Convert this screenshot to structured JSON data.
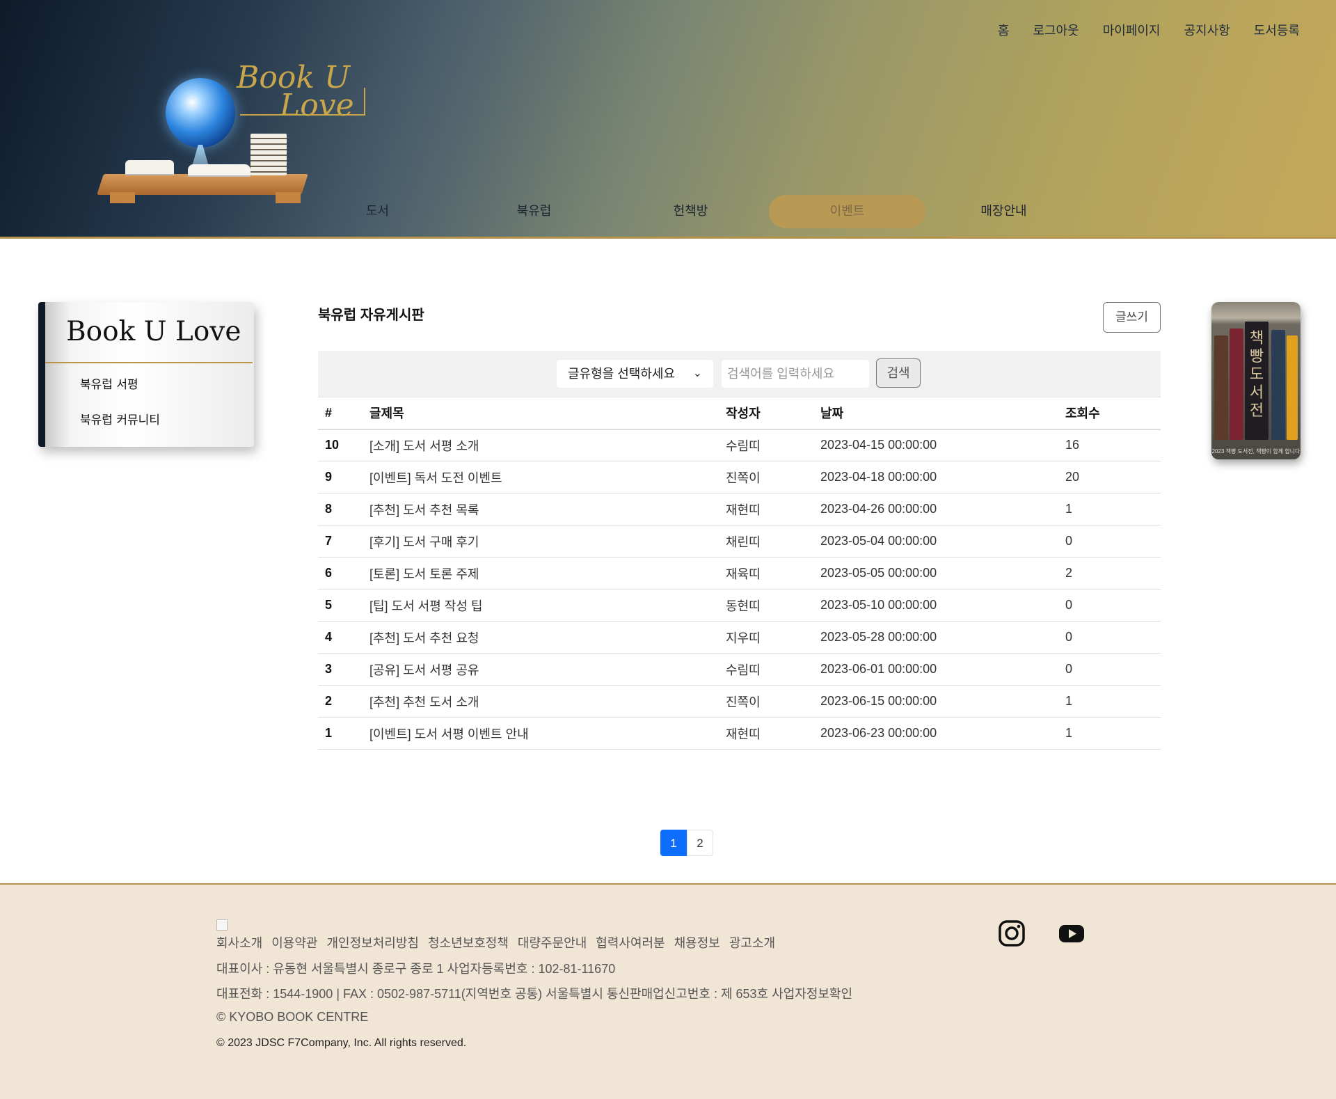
{
  "header": {
    "top_nav": [
      "홈",
      "로그아웃",
      "마이페이지",
      "공지사항",
      "도서등록"
    ],
    "logo_text": [
      "Book U",
      "Love"
    ],
    "main_nav": [
      "도서",
      "북유럽",
      "헌책방",
      "이벤트",
      "매장안내"
    ],
    "active_main_nav": "이벤트"
  },
  "sidebar": {
    "title": "Book U Love",
    "items": [
      "북유럽 서평",
      "북유럽 커뮤니티"
    ]
  },
  "board": {
    "title": "북유럽 자유게시판",
    "write_button": "글쓰기",
    "select_label": "글유형을 선택하세요",
    "search_placeholder": "검색어를 입력하세요",
    "search_button": "검색",
    "columns": [
      "#",
      "글제목",
      "작성자",
      "날짜",
      "조회수"
    ],
    "rows": [
      {
        "num": "10",
        "title": "[소개] 도서 서평 소개",
        "author": "수림띠",
        "date": "2023-04-15 00:00:00",
        "views": "16"
      },
      {
        "num": "9",
        "title": "[이벤트] 독서 도전 이벤트",
        "author": "진쪽이",
        "date": "2023-04-18 00:00:00",
        "views": "20"
      },
      {
        "num": "8",
        "title": "[추천] 도서 추천 목록",
        "author": "재현띠",
        "date": "2023-04-26 00:00:00",
        "views": "1"
      },
      {
        "num": "7",
        "title": "[후기] 도서 구매 후기",
        "author": "채린띠",
        "date": "2023-05-04 00:00:00",
        "views": "0"
      },
      {
        "num": "6",
        "title": "[토론] 도서 토론 주제",
        "author": "재육띠",
        "date": "2023-05-05 00:00:00",
        "views": "2"
      },
      {
        "num": "5",
        "title": "[팁] 도서 서평 작성 팁",
        "author": "동현띠",
        "date": "2023-05-10 00:00:00",
        "views": "0"
      },
      {
        "num": "4",
        "title": "[추천] 도서 추천 요청",
        "author": "지우띠",
        "date": "2023-05-28 00:00:00",
        "views": "0"
      },
      {
        "num": "3",
        "title": "[공유] 도서 서평 공유",
        "author": "수림띠",
        "date": "2023-06-01 00:00:00",
        "views": "0"
      },
      {
        "num": "2",
        "title": "[추천] 추천 도서 소개",
        "author": "진쪽이",
        "date": "2023-06-15 00:00:00",
        "views": "1"
      },
      {
        "num": "1",
        "title": "[이벤트] 도서 서평 이벤트 안내",
        "author": "재현띠",
        "date": "2023-06-23 00:00:00",
        "views": "1"
      }
    ]
  },
  "right_banner": {
    "text": "책빵도서전",
    "caption": "2023 책빵 도서전, 책빵이 함께 합니다"
  },
  "pagination": {
    "pages": [
      "1",
      "2"
    ],
    "current": "1"
  },
  "footer": {
    "links": [
      "회사소개",
      "이용약관",
      "개인정보처리방침",
      "청소년보호정책",
      "대량주문안내",
      "협력사여러분",
      "채용정보",
      "광고소개"
    ],
    "line1": "대표이사 : 유동현 서울특별시 종로구 종로 1 사업자등록번호 : 102-81-11670",
    "line2": "대표전화 : 1544-1900 | FAX : 0502-987-5711(지역번호 공통) 서울특별시 통신판매업신고번호 : 제 653호 사업자정보확인",
    "line3": "© KYOBO BOOK CENTRE",
    "copyright": "© 2023 JDSC F7Company, Inc. All rights reserved.",
    "social": [
      "instagram-icon",
      "youtube-icon"
    ]
  },
  "colors": {
    "accent_gold": "#b8944c",
    "active_nav": "#b99a55",
    "pagination_active": "#0d6efd",
    "footer_bg": "#f1e6d6"
  }
}
